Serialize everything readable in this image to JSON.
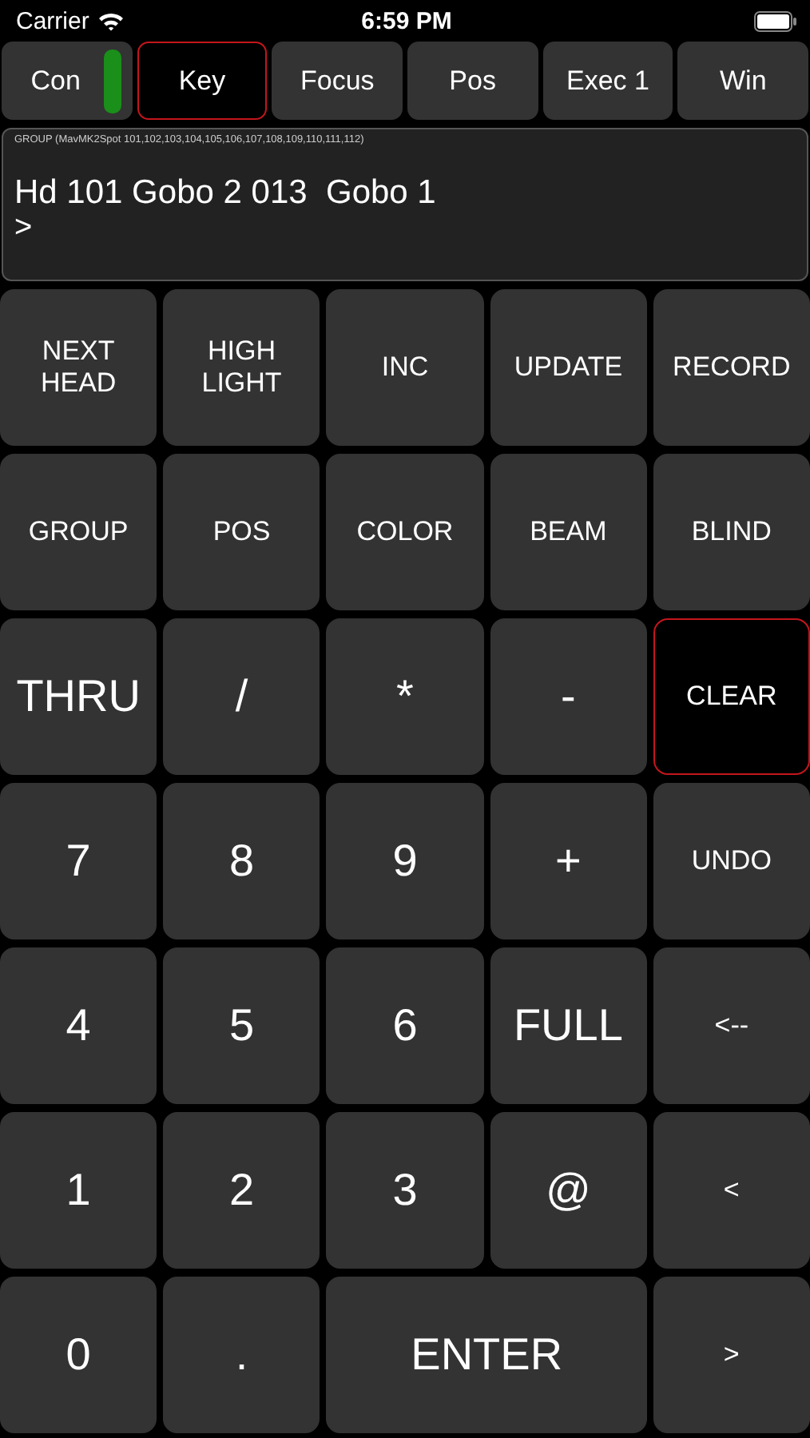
{
  "status_bar": {
    "carrier": "Carrier",
    "time": "6:59 PM"
  },
  "tabs": [
    {
      "label": "Con",
      "selected": false,
      "connected": true
    },
    {
      "label": "Key",
      "selected": true
    },
    {
      "label": "Focus",
      "selected": false
    },
    {
      "label": "Pos",
      "selected": false
    },
    {
      "label": "Exec 1",
      "selected": false
    },
    {
      "label": "Win",
      "selected": false
    }
  ],
  "command_display": {
    "group": "GROUP (MavMK2Spot 101,102,103,104,105,106,107,108,109,110,111,112)",
    "command": "Hd 101 Gobo 2 013  Gobo 1",
    "prompt": ">"
  },
  "keys": [
    {
      "label": "NEXT\nHEAD",
      "kind": "word",
      "active": false
    },
    {
      "label": "HIGH\nLIGHT",
      "kind": "word",
      "active": false
    },
    {
      "label": "INC",
      "kind": "word",
      "active": false
    },
    {
      "label": "UPDATE",
      "kind": "word",
      "active": false
    },
    {
      "label": "RECORD",
      "kind": "word",
      "active": false
    },
    {
      "label": "GROUP",
      "kind": "word",
      "active": false
    },
    {
      "label": "POS",
      "kind": "word",
      "active": false
    },
    {
      "label": "COLOR",
      "kind": "word",
      "active": false
    },
    {
      "label": "BEAM",
      "kind": "word",
      "active": false
    },
    {
      "label": "BLIND",
      "kind": "word",
      "active": false
    },
    {
      "label": "THRU",
      "kind": "big",
      "active": false
    },
    {
      "label": "/",
      "kind": "big",
      "active": false
    },
    {
      "label": "*",
      "kind": "big",
      "active": false
    },
    {
      "label": "-",
      "kind": "big",
      "active": false
    },
    {
      "label": "CLEAR",
      "kind": "word",
      "active": true
    },
    {
      "label": "7",
      "kind": "big",
      "active": false
    },
    {
      "label": "8",
      "kind": "big",
      "active": false
    },
    {
      "label": "9",
      "kind": "big",
      "active": false
    },
    {
      "label": "+",
      "kind": "big",
      "active": false
    },
    {
      "label": "UNDO",
      "kind": "word",
      "active": false
    },
    {
      "label": "4",
      "kind": "big",
      "active": false
    },
    {
      "label": "5",
      "kind": "big",
      "active": false
    },
    {
      "label": "6",
      "kind": "big",
      "active": false
    },
    {
      "label": "FULL",
      "kind": "big",
      "active": false
    },
    {
      "label": "<--",
      "kind": "word",
      "active": false
    },
    {
      "label": "1",
      "kind": "big",
      "active": false
    },
    {
      "label": "2",
      "kind": "big",
      "active": false
    },
    {
      "label": "3",
      "kind": "big",
      "active": false
    },
    {
      "label": "@",
      "kind": "big",
      "active": false
    },
    {
      "label": "<",
      "kind": "word",
      "active": false
    },
    {
      "label": "0",
      "kind": "big",
      "active": false
    },
    {
      "label": ".",
      "kind": "big",
      "active": false
    },
    {
      "label": "ENTER",
      "kind": "wide",
      "active": false
    },
    {
      "label": ">",
      "kind": "word",
      "active": false
    }
  ]
}
